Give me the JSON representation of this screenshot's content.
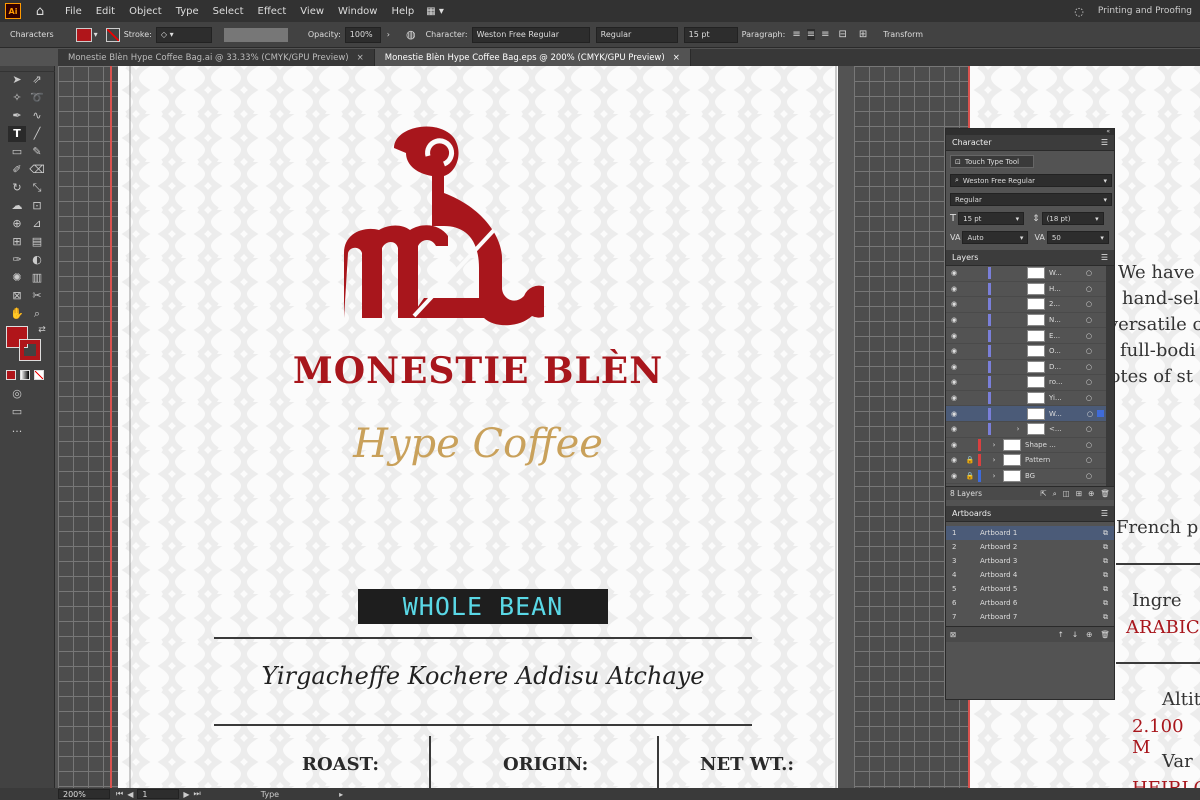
{
  "app": {
    "icon_label": "Ai",
    "workspace": "Printing and Proofing"
  },
  "menu": [
    "File",
    "Edit",
    "Object",
    "Type",
    "Select",
    "Effect",
    "View",
    "Window",
    "Help"
  ],
  "control": {
    "panel_label": "Characters",
    "stroke_label": "Stroke:",
    "opacity_label": "Opacity:",
    "opacity_value": "100%",
    "character_label": "Character:",
    "font": "Weston Free Regular",
    "style": "Regular",
    "size": "15 pt",
    "paragraph_label": "Paragraph:",
    "transform_label": "Transform"
  },
  "tabs": [
    {
      "label": "Monestie Blèn Hype Coffee Bag.ai @ 33.33% (CMYK/GPU Preview)",
      "active": false
    },
    {
      "label": "Monestie Blèn Hype Coffee Bag.eps @ 200% (CMYK/GPU Preview)",
      "active": true
    }
  ],
  "artboard": {
    "brand": "MONESTIE BLÈN",
    "tagline": "Hype Coffee",
    "badge": "WHOLE BEAN",
    "origin_script": "Yirgacheffe Kochere Addisu Atchaye",
    "fields": [
      "ROAST:",
      "ORIGIN:",
      "NET WT.:"
    ]
  },
  "artboard2": {
    "lines": [
      "We have",
      "hand-sel",
      "versatile c",
      "full-bodi",
      "notes of st"
    ],
    "french": "French p",
    "ingr_label": "Ingre",
    "ingr_value": "ARABIC",
    "alt_label": "Altit",
    "alt_value": "2.100 M",
    "var_label": "Var",
    "var_value": "HEIRLO"
  },
  "character_panel": {
    "title": "Character",
    "touch_type": "Touch Type Tool",
    "font": "Weston Free Regular",
    "style": "Regular",
    "size": "15 pt",
    "leading": "(18 pt)",
    "kerning": "Auto",
    "tracking": "50"
  },
  "layers_panel": {
    "title": "Layers",
    "count": "8 Layers",
    "rows": [
      {
        "name": "W...",
        "selected": false
      },
      {
        "name": "H...",
        "selected": false
      },
      {
        "name": "2...",
        "selected": false
      },
      {
        "name": "N...",
        "selected": false
      },
      {
        "name": "E...",
        "selected": false
      },
      {
        "name": "O...",
        "selected": false
      },
      {
        "name": "D...",
        "selected": false
      },
      {
        "name": "ro...",
        "selected": false
      },
      {
        "name": "Yi...",
        "selected": false
      },
      {
        "name": "W...",
        "selected": true
      },
      {
        "name": "<...",
        "selected": false
      },
      {
        "name": "Shape ...",
        "selected": false
      },
      {
        "name": "Pattern",
        "selected": false
      },
      {
        "name": "BG",
        "selected": false
      }
    ]
  },
  "artboards_panel": {
    "title": "Artboards",
    "rows": [
      {
        "num": "1",
        "name": "Artboard 1"
      },
      {
        "num": "2",
        "name": "Artboard 2"
      },
      {
        "num": "3",
        "name": "Artboard 3"
      },
      {
        "num": "4",
        "name": "Artboard 4"
      },
      {
        "num": "5",
        "name": "Artboard 5"
      },
      {
        "num": "6",
        "name": "Artboard 6"
      },
      {
        "num": "7",
        "name": "Artboard 7"
      }
    ]
  },
  "status": {
    "zoom": "200%",
    "page": "1",
    "tool": "Type"
  },
  "colors": {
    "brand_red": "#a8161c",
    "gold": "#c9a15b",
    "badge_text": "#5ad8e6",
    "panel_sel": "#4b5b78"
  }
}
